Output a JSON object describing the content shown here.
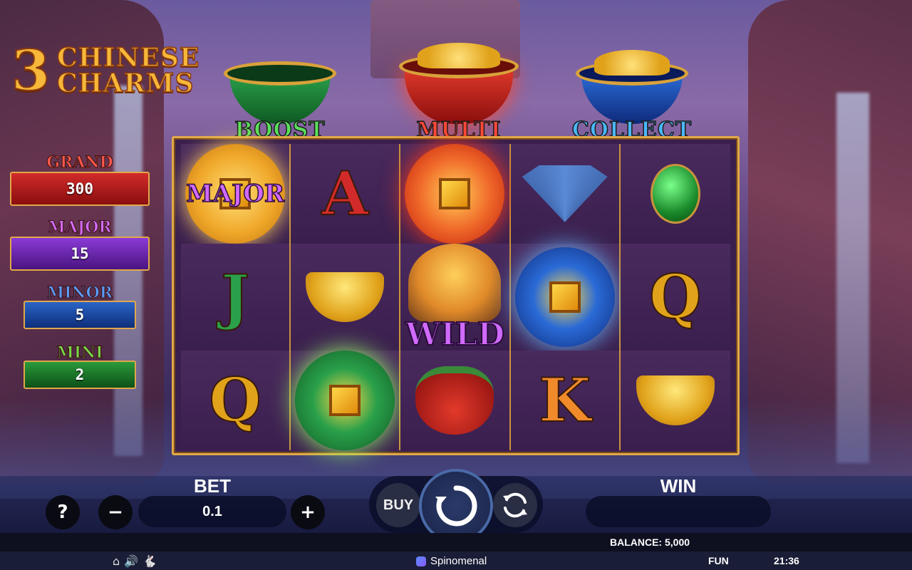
{
  "logo": {
    "number": "3",
    "word1": "CHINESE",
    "word2": "CHARMS"
  },
  "jackpots": {
    "grand": {
      "label": "GRAND",
      "value": "300"
    },
    "major": {
      "label": "MAJOR",
      "value": "15"
    },
    "minor": {
      "label": "MINOR",
      "value": "5"
    },
    "mini": {
      "label": "MINI",
      "value": "2"
    }
  },
  "pots": {
    "boost": "BOOST",
    "multi": "MULTI",
    "collect": "COLLECT"
  },
  "reels": {
    "coin_major_caption": "MAJOR",
    "letter_a": "A",
    "letter_j": "J",
    "letter_q": "Q",
    "letter_k": "K",
    "wild_caption": "WILD"
  },
  "controls": {
    "help_icon": "?",
    "bet_label": "BET",
    "bet_value": "0.1",
    "minus_icon": "−",
    "plus_icon": "+",
    "buy_label": "BUY",
    "win_label": "WIN",
    "win_value": ""
  },
  "status": {
    "balance": "BALANCE: 5,000"
  },
  "footer": {
    "home_icon": "⌂",
    "sound_icon": "🔊",
    "turbo_icon": "🐇",
    "brand": "Spinomenal",
    "mode": "FUN",
    "time": "21:36"
  },
  "colors": {
    "frame_gold": "#e0a84a",
    "reel_bg": "#3a1f4e"
  }
}
